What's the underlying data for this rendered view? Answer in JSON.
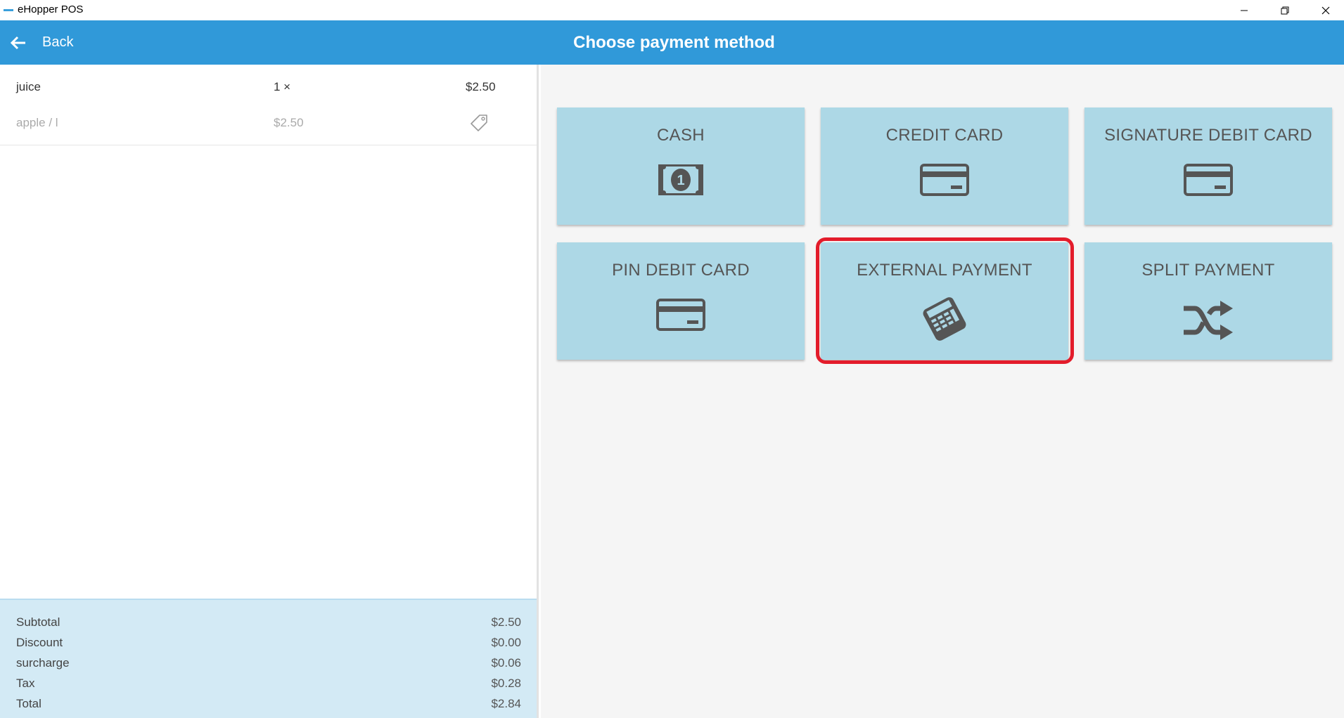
{
  "window": {
    "title": "eHopper POS"
  },
  "header": {
    "back_label": "Back",
    "title": "Choose payment method"
  },
  "order": {
    "items": [
      {
        "name": "juice",
        "qty": "1 ×",
        "price": "$2.50",
        "modifier": "apple / l",
        "unit_price": "$2.50"
      }
    ]
  },
  "totals": [
    {
      "label": "Subtotal",
      "value": "$2.50"
    },
    {
      "label": "Discount",
      "value": "$0.00"
    },
    {
      "label": "surcharge",
      "value": "$0.06"
    },
    {
      "label": "Tax",
      "value": "$0.28"
    },
    {
      "label": "Total",
      "value": "$2.84"
    }
  ],
  "payment_methods": [
    {
      "label": "CASH",
      "icon": "cash-icon"
    },
    {
      "label": "CREDIT CARD",
      "icon": "credit-card-icon"
    },
    {
      "label": "SIGNATURE DEBIT CARD",
      "icon": "credit-card-icon"
    },
    {
      "label": "PIN DEBIT CARD",
      "icon": "credit-card-icon"
    },
    {
      "label": "EXTERNAL PAYMENT",
      "icon": "card-terminal-icon"
    },
    {
      "label": "SPLIT PAYMENT",
      "icon": "shuffle-icon"
    }
  ],
  "colors": {
    "header": "#3099d9",
    "tile": "#add8e6",
    "highlight": "#e31c2b",
    "totals_bg": "#d3eaf5"
  }
}
